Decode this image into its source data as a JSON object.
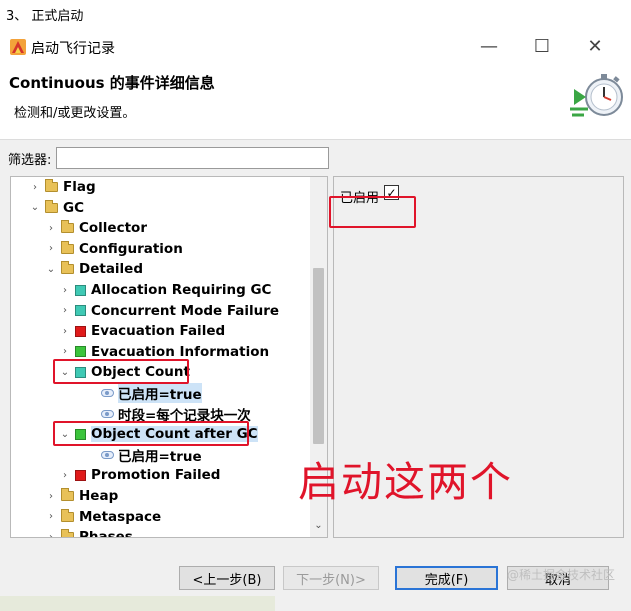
{
  "step_caption": "3、 正式启动",
  "window": {
    "title": "启动飞行记录",
    "minimize": "—",
    "maximize": "☐",
    "close": "✕"
  },
  "header": {
    "title": "Continuous 的事件详细信息",
    "description": "检测和/或更改设置。"
  },
  "filter": {
    "label": "筛选器:",
    "value": ""
  },
  "tree": [
    {
      "label": "Flag",
      "kind": "folder",
      "arrow": "›",
      "level": 1
    },
    {
      "label": "GC",
      "kind": "folder",
      "arrow": "⌄",
      "level": 1
    },
    {
      "label": "Collector",
      "kind": "folder",
      "arrow": "›",
      "level": 2
    },
    {
      "label": "Configuration",
      "kind": "folder",
      "arrow": "›",
      "level": 2
    },
    {
      "label": "Detailed",
      "kind": "folder",
      "arrow": "⌄",
      "level": 2
    },
    {
      "label": "Allocation Requiring GC",
      "kind": "event",
      "arrow": "›",
      "level": 3,
      "color": "#3fc9b4"
    },
    {
      "label": "Concurrent Mode Failure",
      "kind": "event",
      "arrow": "›",
      "level": 3,
      "color": "#3fc9b4"
    },
    {
      "label": "Evacuation Failed",
      "kind": "event",
      "arrow": "›",
      "level": 3,
      "color": "#e01a1a"
    },
    {
      "label": "Evacuation Information",
      "kind": "event",
      "arrow": "›",
      "level": 3,
      "color": "#3cc43c"
    },
    {
      "label": "Object Count",
      "kind": "event",
      "arrow": "⌄",
      "level": 3,
      "color": "#3fc9b4"
    },
    {
      "label": "已启用=true",
      "kind": "prop",
      "arrow": "",
      "level": 4,
      "selected": true
    },
    {
      "label": "时段=每个记录块一次",
      "kind": "prop",
      "arrow": "",
      "level": 4
    },
    {
      "label": "Object Count after GC",
      "kind": "event",
      "arrow": "⌄",
      "level": 3,
      "color": "#3cc43c",
      "selected": true
    },
    {
      "label": "已启用=true",
      "kind": "prop",
      "arrow": "",
      "level": 4
    },
    {
      "label": "Promotion Failed",
      "kind": "event",
      "arrow": "›",
      "level": 3,
      "color": "#e01a1a"
    },
    {
      "label": "Heap",
      "kind": "folder",
      "arrow": "›",
      "level": 2
    },
    {
      "label": "Metaspace",
      "kind": "folder",
      "arrow": "›",
      "level": 2
    },
    {
      "label": "Phases",
      "kind": "folder",
      "arrow": "›",
      "level": 2
    }
  ],
  "detail": {
    "enabled_label": "已启用",
    "enabled_checked": true,
    "check_mark": "✓"
  },
  "annotation": "启动这两个",
  "buttons": {
    "back": "<上一步(B)",
    "next": "下一步(N)>",
    "finish": "完成(F)",
    "cancel": "取消"
  },
  "watermark": "@稀土掘金技术社区",
  "colors": {
    "annotation_red": "#e0142a",
    "selection": "#cde3f7",
    "finish_border": "#2a74d6"
  }
}
